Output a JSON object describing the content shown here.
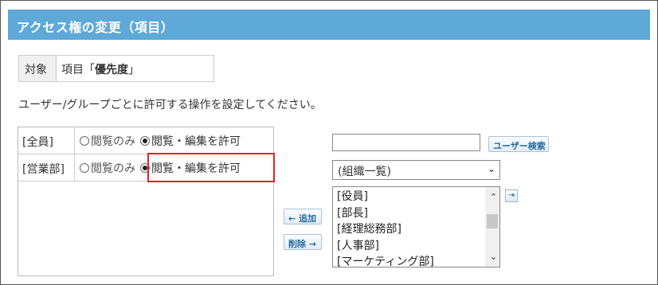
{
  "header": {
    "title": "アクセス権の変更（項目）"
  },
  "target": {
    "label": "対象",
    "prefix": "項目「",
    "item": "優先度",
    "suffix": "」"
  },
  "description": "ユーザー/グループごとに許可する操作を設定してください。",
  "permissions": {
    "rows": [
      {
        "name": "[全員]",
        "option_view": "閲覧のみ",
        "option_edit": "閲覧・編集を許可",
        "selected": "edit"
      },
      {
        "name": "[営業部]",
        "option_view": "閲覧のみ",
        "option_edit": "閲覧・編集を許可",
        "selected": "edit"
      }
    ]
  },
  "buttons": {
    "add": "← 追加",
    "delete": "削除 →",
    "user_search": "ユーザー検索"
  },
  "user_search_input": {
    "value": "",
    "placeholder": ""
  },
  "org_select": {
    "value": "(組織一覧)"
  },
  "listbox": {
    "items": [
      "[役員]",
      "[部長]",
      "[経理総務部]",
      "[人事部]",
      "[マーケティング部]"
    ]
  },
  "icons": {
    "add_to_list": "arrow-into-list-icon",
    "radio_on": "radio-checked-icon",
    "radio_off": "radio-unchecked-icon",
    "dropdown": "chevron-down-icon"
  },
  "colors": {
    "header_bg": "#5ea9d8",
    "highlight": "#e0252b",
    "button_text": "#2a6aa0"
  }
}
